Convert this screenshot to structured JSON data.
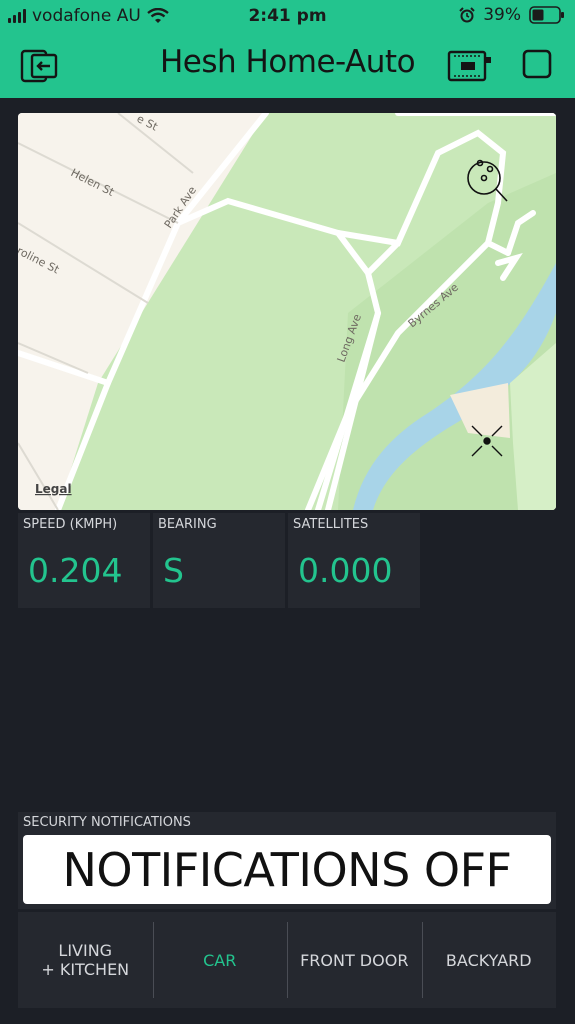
{
  "status_bar": {
    "carrier": "vodafone AU",
    "time": "2:41 pm",
    "battery": "39%"
  },
  "app": {
    "title": "Hesh Home-Auto",
    "accent_color": "#23c48e"
  },
  "map": {
    "legal": "Legal",
    "streets": [
      "Helen St",
      "roline St",
      "Park Ave",
      "Long Ave",
      "Byrnes Ave",
      "e St"
    ]
  },
  "tiles": [
    {
      "label": "SPEED (KMPH)",
      "value": "0.204"
    },
    {
      "label": "BEARING",
      "value": "S"
    },
    {
      "label": "SATELLITES",
      "value": "0.000"
    }
  ],
  "notifications": {
    "label": "SECURITY NOTIFICATIONS",
    "button": "NOTIFICATIONS OFF"
  },
  "tabs": [
    {
      "line1": "LIVING",
      "line2": "+ KITCHEN",
      "active": false
    },
    {
      "line1": "CAR",
      "line2": "",
      "active": true
    },
    {
      "line1": "FRONT DOOR",
      "line2": "",
      "active": false
    },
    {
      "line1": "BACKYARD",
      "line2": "",
      "active": false
    }
  ]
}
